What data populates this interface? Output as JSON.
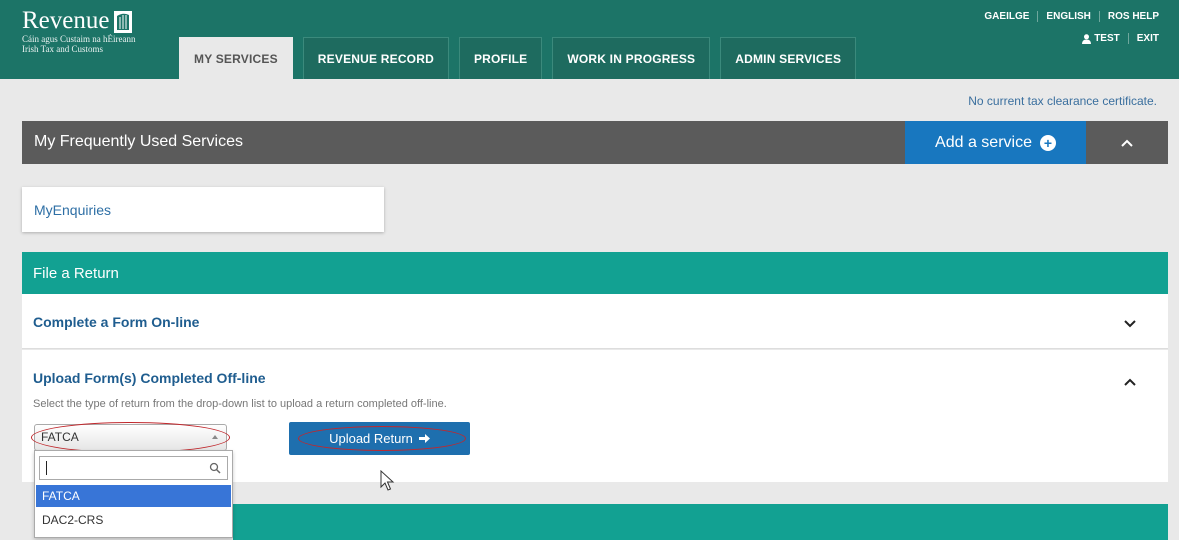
{
  "header": {
    "brand": "Revenue",
    "subtitle_irish": "Cáin agus Custaim na hÉireann",
    "subtitle_english": "Irish Tax and Customs",
    "tabs": [
      {
        "label": "MY SERVICES",
        "active": true
      },
      {
        "label": "REVENUE RECORD",
        "active": false
      },
      {
        "label": "PROFILE",
        "active": false
      },
      {
        "label": "WORK IN PROGRESS",
        "active": false
      },
      {
        "label": "ADMIN SERVICES",
        "active": false
      }
    ],
    "top_links": [
      "GAEILGE",
      "ENGLISH",
      "ROS HELP"
    ],
    "user": "TEST",
    "exit": "EXIT"
  },
  "clearance_text": "No current tax clearance certificate.",
  "frequent": {
    "title": "My Frequently Used Services",
    "add_label": "Add a service",
    "items": [
      "MyEnquiries"
    ]
  },
  "file_return": {
    "title": "File a Return",
    "complete_online": "Complete a Form On-line",
    "upload_offline": "Upload Form(s) Completed Off-line",
    "description": "Select the type of return from the drop-down list to upload a return completed off-line.",
    "selected_type": "FATCA",
    "upload_button": "Upload Return",
    "options": [
      "FATCA",
      "DAC2-CRS"
    ]
  },
  "colors": {
    "header": "#1c7467",
    "teal": "#12a192",
    "blue": "#1877bf",
    "dark_bar": "#5b5b5b",
    "annotation": "#c0282d"
  },
  "icons": [
    "harp-icon",
    "plus-circle-icon",
    "chevron-up-icon",
    "chevron-down-icon",
    "user-icon",
    "arrow-right-icon",
    "search-icon",
    "mouse-cursor-icon"
  ]
}
